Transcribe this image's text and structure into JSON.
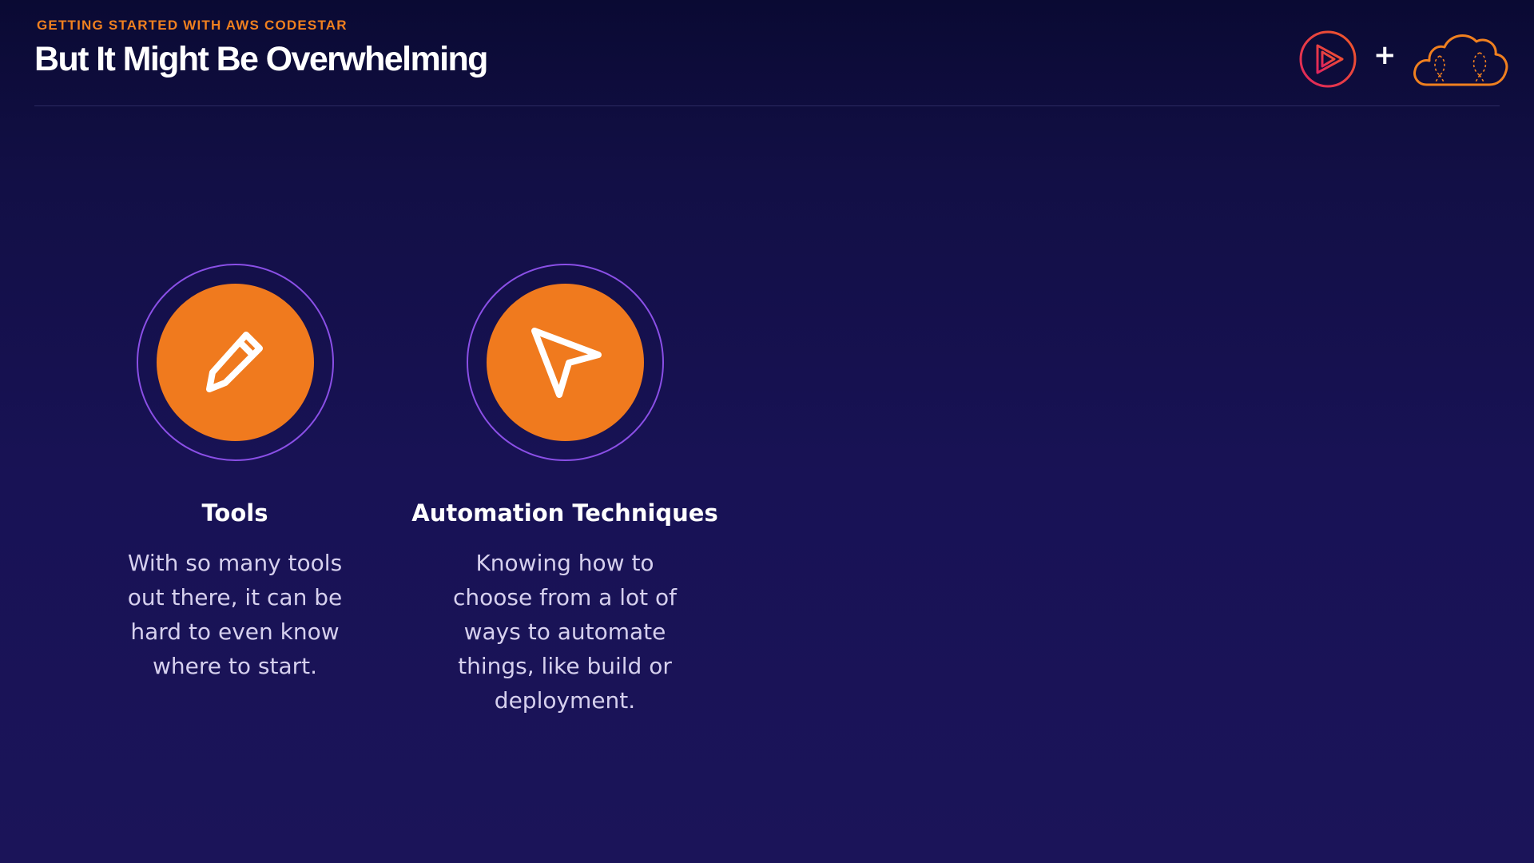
{
  "header": {
    "kicker": "GETTING STARTED WITH AWS CODESTAR",
    "title": "But It Might Be Overwhelming",
    "plus": "+"
  },
  "logos": [
    {
      "icon": "pluralsight-play-icon",
      "color": "#e0245e"
    },
    {
      "icon": "aws-cloud-icon",
      "color": "#f0801f"
    }
  ],
  "features": [
    {
      "icon": "pencil-icon",
      "title": "Tools",
      "description": "With so many tools out there, it can be hard to even know where to start."
    },
    {
      "icon": "navigation-arrow-icon",
      "title": "Automation Techniques",
      "description": "Knowing how to choose from a lot of ways to automate things, like build or deployment."
    }
  ],
  "colors": {
    "accent": "#f07a1e",
    "ring": "#8a4fe6",
    "background": "#181255",
    "text_muted": "#d6d0ee"
  }
}
